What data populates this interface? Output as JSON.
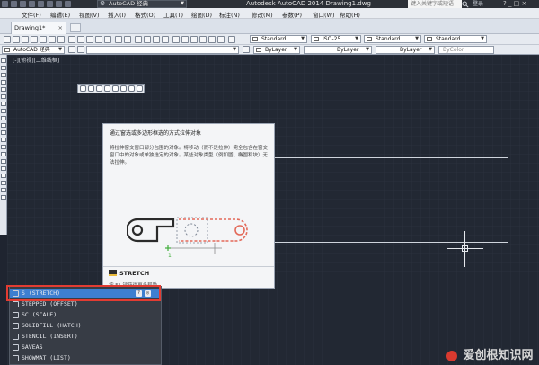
{
  "titlebar": {
    "workspace": "AutoCAD 经典",
    "app_title": "Autodesk AutoCAD 2014    Drawing1.dwg",
    "search_placeholder": "键入关键字或短语",
    "signin": "登录",
    "window_controls": "? _ □ ×"
  },
  "menubar": {
    "items": [
      "文件(F)",
      "编辑(E)",
      "视图(V)",
      "插入(I)",
      "格式(O)",
      "工具(T)",
      "绘图(D)",
      "标注(N)",
      "修改(M)",
      "参数(P)",
      "窗口(W)",
      "帮助(H)"
    ]
  },
  "tabs": {
    "drawing": "Drawing1*",
    "close": "×"
  },
  "toolbar1": {
    "text_style": "Standard",
    "dim_style": "ISO-25",
    "table_style": "Standard",
    "multileader_style": "Standard"
  },
  "toolbar2": {
    "workspace": "AutoCAD 经典",
    "layer": "ByLayer",
    "linetype": "ByLayer",
    "lineweight": "ByLayer",
    "plot_color": "ByColor"
  },
  "canvas": {
    "viewport_label": "[-][俯视][二维线框]"
  },
  "tooltip": {
    "title": "通过窗选或多边形框选的方式拉伸对象",
    "description": "将拉伸窗交窗口部分包围的对象。将移动（而不是拉伸）完全包含在窗交窗口中的对象或单独选定的对象。某些对象类型（例如圆、椭圆和块）无法拉伸。",
    "command": "STRETCH",
    "help": "按 F1 键获得更多帮助",
    "point_label": "1"
  },
  "autocomplete": {
    "items": [
      {
        "label": "S (STRETCH)",
        "selected": true
      },
      {
        "label": "STEPPED (OFFSET)",
        "selected": false
      },
      {
        "label": "SC (SCALE)",
        "selected": false
      },
      {
        "label": "SOLIDFILL (HATCH)",
        "selected": false
      },
      {
        "label": "STENCIL (INSERT)",
        "selected": false
      },
      {
        "label": "SAVEAS",
        "selected": false
      },
      {
        "label": "SHOWMAT (LIST)",
        "selected": false
      }
    ]
  },
  "watermark": {
    "text": "爱创根知识网"
  },
  "colors": {
    "canvas_bg": "#222833",
    "selection": "#3d7fd0",
    "highlight_border": "#e33c32",
    "stretch_object": "#e36a5a"
  }
}
